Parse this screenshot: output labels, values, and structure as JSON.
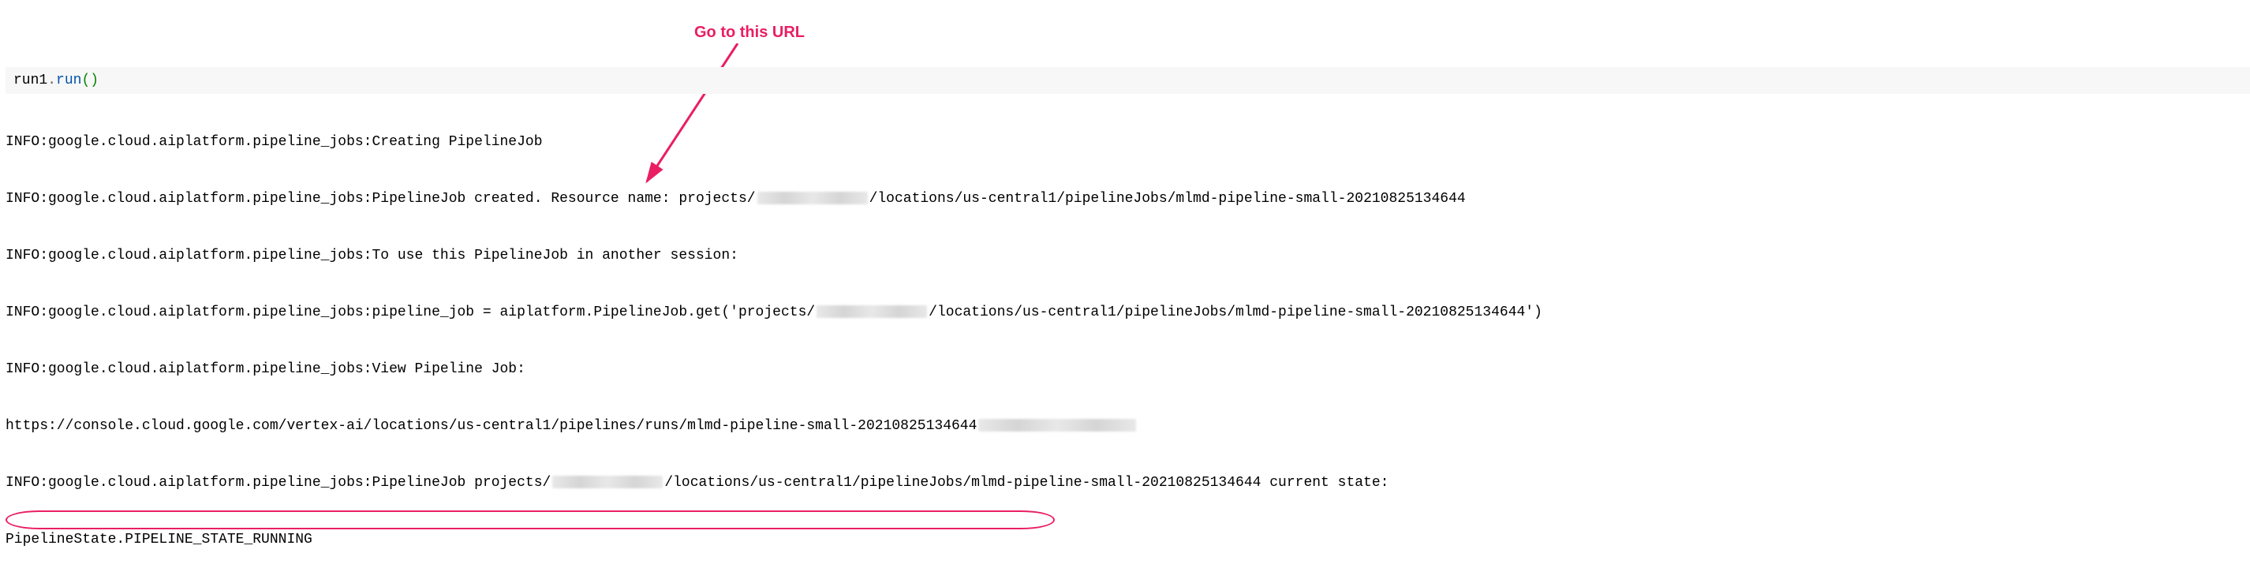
{
  "annotation": {
    "label": "Go to this URL"
  },
  "code": {
    "object": "run1",
    "dot": ".",
    "method": "run",
    "parens": "()"
  },
  "log": {
    "l1a": "INFO:google.cloud.aiplatform.pipeline_jobs:Creating PipelineJob",
    "l2a": "INFO:google.cloud.aiplatform.pipeline_jobs:PipelineJob created. Resource name: projects/",
    "l2b": "/locations/us-central1/pipelineJobs/mlmd-pipeline-small-20210825134644",
    "l3a": "INFO:google.cloud.aiplatform.pipeline_jobs:To use this PipelineJob in another session:",
    "l4a": "INFO:google.cloud.aiplatform.pipeline_jobs:pipeline_job = aiplatform.PipelineJob.get('projects/",
    "l4b": "/locations/us-central1/pipelineJobs/mlmd-pipeline-small-20210825134644')",
    "l5a": "INFO:google.cloud.aiplatform.pipeline_jobs:View Pipeline Job:",
    "l6a": "https://console.cloud.google.com/vertex-ai/locations/us-central1/pipelines/runs/mlmd-pipeline-small-20210825134644",
    "l7a": "INFO:google.cloud.aiplatform.pipeline_jobs:PipelineJob projects/",
    "l7b": "/locations/us-central1/pipelineJobs/mlmd-pipeline-small-20210825134644 current state:",
    "l8a": "PipelineState.PIPELINE_STATE_RUNNING"
  },
  "colors": {
    "accent": "#e91e63"
  }
}
